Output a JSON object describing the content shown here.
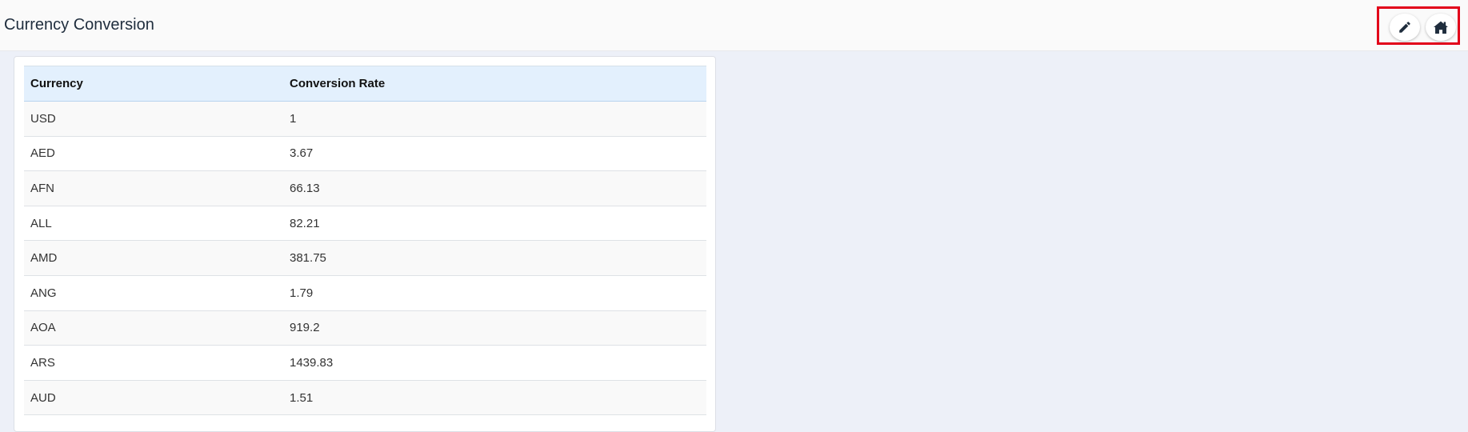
{
  "header": {
    "title": "Currency Conversion",
    "actions": [
      {
        "name": "edit",
        "icon": "pencil-icon"
      },
      {
        "name": "home",
        "icon": "home-icon"
      }
    ],
    "highlight_color": "#e2001a"
  },
  "table": {
    "columns": [
      "Currency",
      "Conversion Rate"
    ],
    "rows": [
      {
        "currency": "USD",
        "rate": "1"
      },
      {
        "currency": "AED",
        "rate": "3.67"
      },
      {
        "currency": "AFN",
        "rate": "66.13"
      },
      {
        "currency": "ALL",
        "rate": "82.21"
      },
      {
        "currency": "AMD",
        "rate": "381.75"
      },
      {
        "currency": "ANG",
        "rate": "1.79"
      },
      {
        "currency": "AOA",
        "rate": "919.2"
      },
      {
        "currency": "ARS",
        "rate": "1439.83"
      },
      {
        "currency": "AUD",
        "rate": "1.51"
      }
    ]
  }
}
